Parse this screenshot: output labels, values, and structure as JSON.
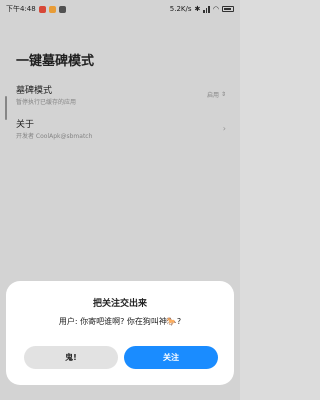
{
  "status_bar": {
    "time": "下午4:48",
    "network_speed": "5.2K/s"
  },
  "page": {
    "title": "一键墓碑模式"
  },
  "settings": [
    {
      "label": "墓碑模式",
      "desc": "暂停执行已缓存的应用",
      "value": "启用"
    },
    {
      "label": "关于",
      "desc": "开发者 CoolApk@sbmatch"
    }
  ],
  "dialog": {
    "title": "把关注交出来",
    "message": "用户: 你寄吧谁啊? 你在狗叫神🐎?",
    "negative_label": "鬼!",
    "positive_label": "关注"
  },
  "colors": {
    "accent": "#1a8cff",
    "background": "#dcdcdc",
    "dialog": "#ffffff"
  }
}
